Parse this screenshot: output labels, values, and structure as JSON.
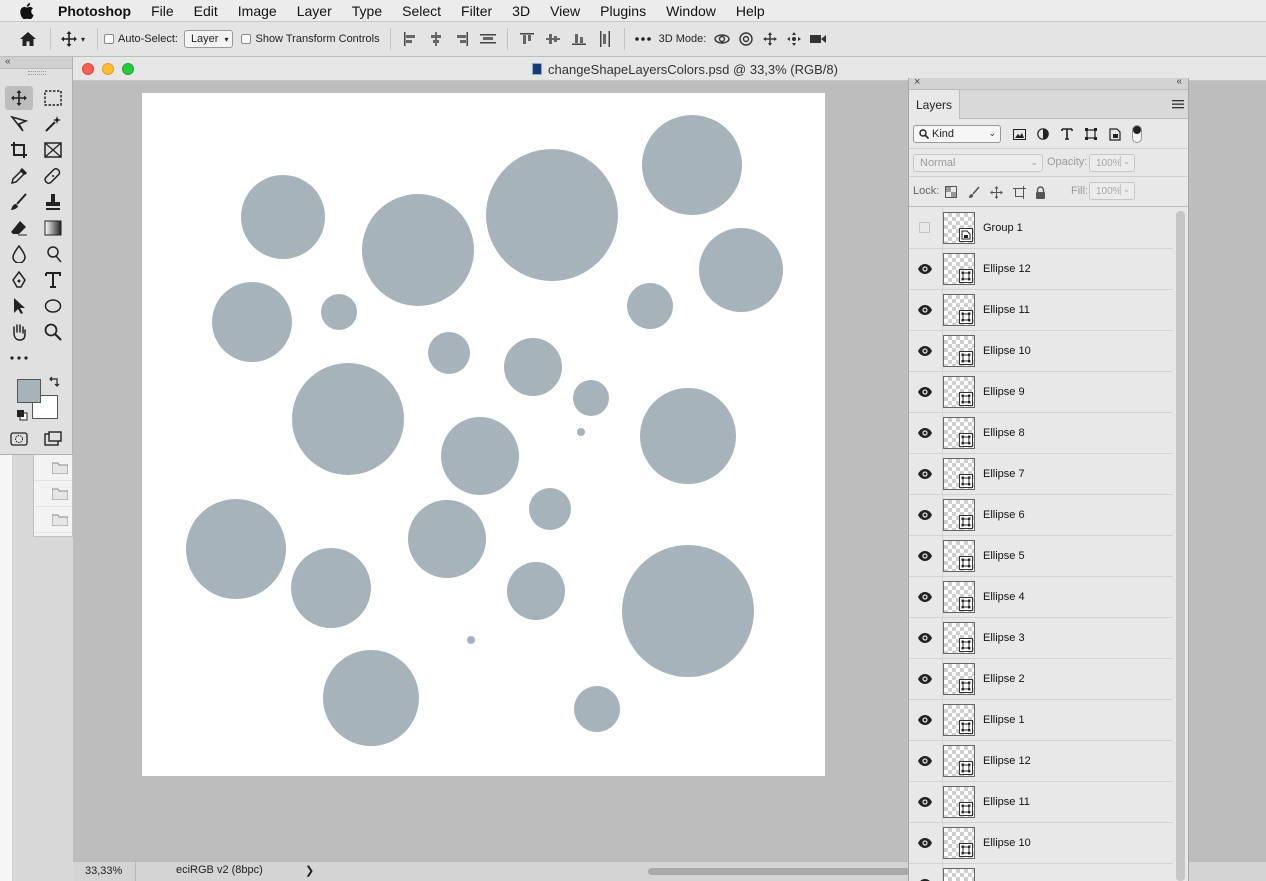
{
  "menubar": {
    "app_name": "Photoshop",
    "items": [
      "File",
      "Edit",
      "Image",
      "Layer",
      "Type",
      "Select",
      "Filter",
      "3D",
      "View",
      "Plugins",
      "Window",
      "Help"
    ]
  },
  "options_bar": {
    "auto_select_label": "Auto-Select:",
    "auto_select_value": "Layer",
    "show_transform_label": "Show Transform Controls",
    "mode_3d_label": "3D Mode:"
  },
  "document": {
    "title": "changeShapeLayersColors.psd @ 33,3% (RGB/8)",
    "zoom": "33,33%",
    "color_profile": "eciRGB v2 (8bpc)",
    "shape_color": "#a7b3bb",
    "background_color": "#ffffff"
  },
  "colors": {
    "foreground": "#a7b3bb",
    "background": "#ffffff"
  },
  "layers_panel": {
    "tab_label": "Layers",
    "filter_kind": "Kind",
    "blend_mode": "Normal",
    "opacity_label": "Opacity:",
    "opacity_value": "100%",
    "lock_label": "Lock:",
    "fill_label": "Fill:",
    "fill_value": "100%",
    "layers": [
      {
        "name": "Group 1",
        "visible": false
      },
      {
        "name": "Ellipse 12",
        "visible": true
      },
      {
        "name": "Ellipse 11",
        "visible": true
      },
      {
        "name": "Ellipse 10",
        "visible": true
      },
      {
        "name": "Ellipse 9",
        "visible": true
      },
      {
        "name": "Ellipse 8",
        "visible": true
      },
      {
        "name": "Ellipse 7",
        "visible": true
      },
      {
        "name": "Ellipse 6",
        "visible": true
      },
      {
        "name": "Ellipse 5",
        "visible": true
      },
      {
        "name": "Ellipse 4",
        "visible": true
      },
      {
        "name": "Ellipse 3",
        "visible": true
      },
      {
        "name": "Ellipse 2",
        "visible": true
      },
      {
        "name": "Ellipse 1",
        "visible": true
      },
      {
        "name": "Ellipse 12",
        "visible": true
      },
      {
        "name": "Ellipse 11",
        "visible": true
      },
      {
        "name": "Ellipse 10",
        "visible": true
      },
      {
        "name": "",
        "visible": true
      }
    ]
  }
}
